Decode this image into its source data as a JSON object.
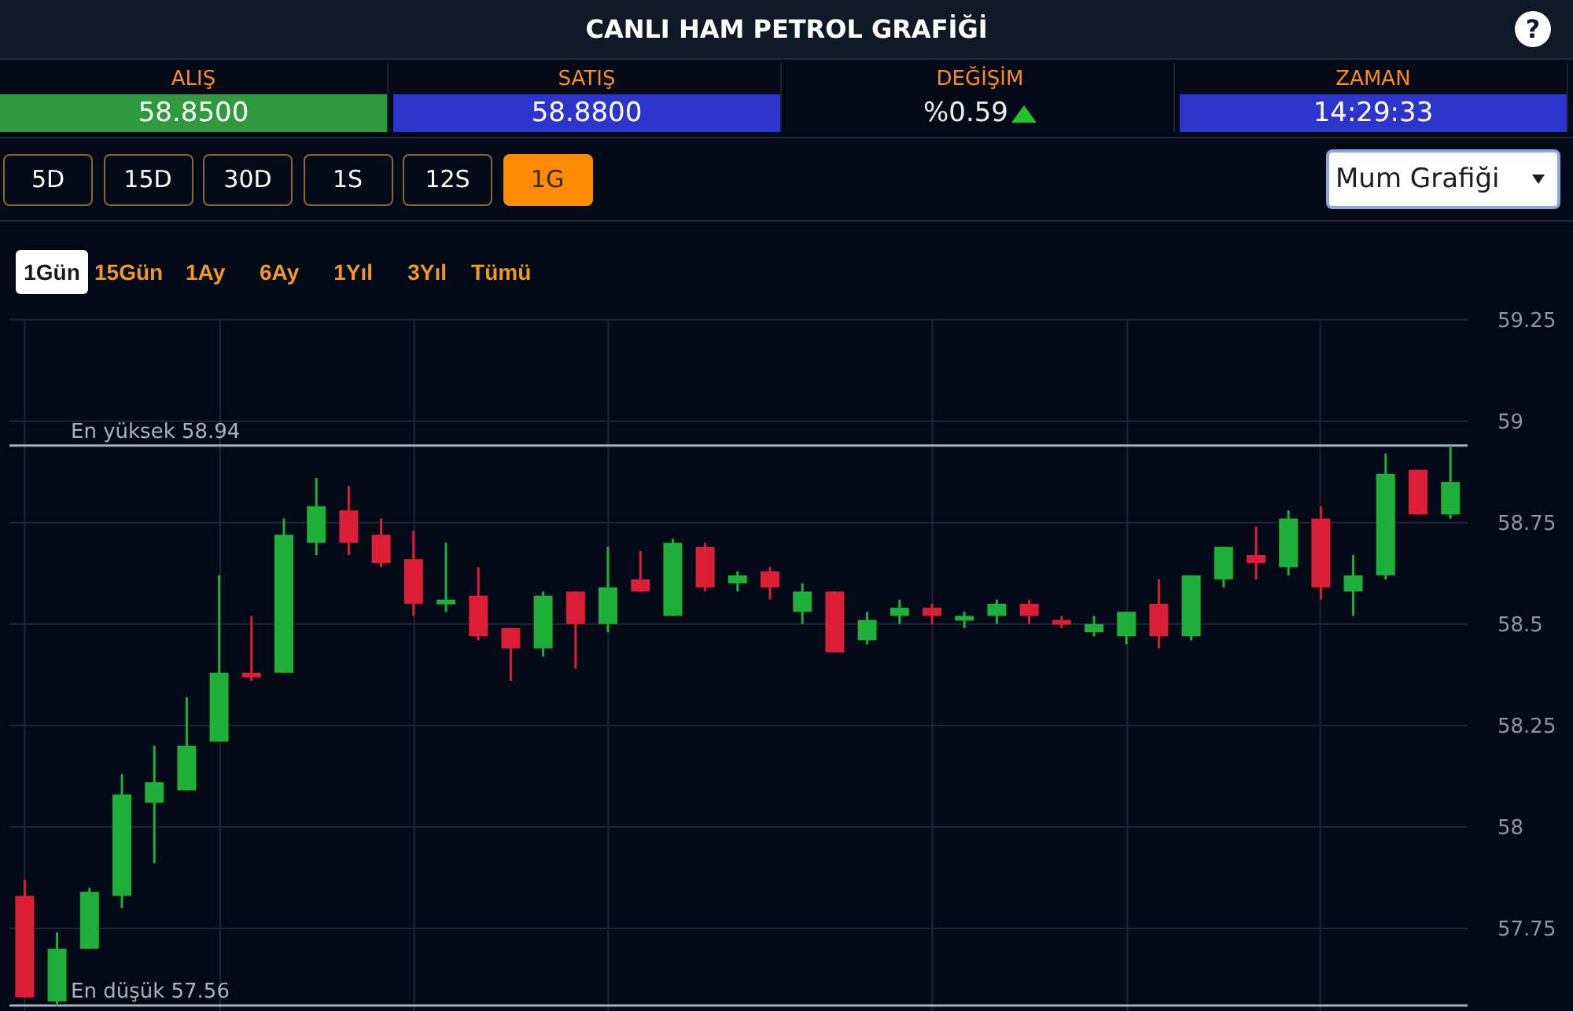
{
  "header": {
    "title": "CANLI HAM PETROL GRAFİĞİ",
    "help": "?"
  },
  "quotes": [
    {
      "kind": "bar",
      "label": "ALIŞ",
      "value": "58.8500",
      "color": "#2e9a3b"
    },
    {
      "kind": "bar",
      "label": "SATIŞ",
      "value": "58.8800",
      "color": "#2b35cc"
    },
    {
      "kind": "change",
      "label": "DEĞİŞİM",
      "value": "%0.59",
      "rising": true
    },
    {
      "kind": "bar",
      "label": "ZAMAN",
      "value": "14:29:33",
      "color": "#2b35cc"
    }
  ],
  "intervals": [
    {
      "label": "5D",
      "selected": false
    },
    {
      "label": "15D",
      "selected": false
    },
    {
      "label": "30D",
      "selected": false
    },
    {
      "label": "1S",
      "selected": false
    },
    {
      "label": "12S",
      "selected": false
    },
    {
      "label": "1G",
      "selected": true
    }
  ],
  "chart_type": {
    "value": "Mum Grafiği"
  },
  "ranges": [
    {
      "label": "1Gün",
      "selected": true
    },
    {
      "label": "15Gün",
      "selected": false
    },
    {
      "label": "1Ay",
      "selected": false
    },
    {
      "label": "6Ay",
      "selected": false
    },
    {
      "label": "1Yıl",
      "selected": false
    },
    {
      "label": "3Yıl",
      "selected": false
    },
    {
      "label": "Tümü",
      "selected": false
    }
  ],
  "chart": {
    "chart_data": {
      "type": "candlestick",
      "ohlc": [
        [
          57.83,
          57.87,
          57.58,
          57.58
        ],
        [
          57.57,
          57.74,
          57.56,
          57.7
        ],
        [
          57.7,
          57.85,
          57.7,
          57.84
        ],
        [
          57.83,
          58.13,
          57.8,
          58.08
        ],
        [
          58.06,
          58.2,
          57.91,
          58.11
        ],
        [
          58.09,
          58.32,
          58.09,
          58.2
        ],
        [
          58.21,
          58.62,
          58.21,
          58.38
        ],
        [
          58.38,
          58.52,
          58.36,
          58.37
        ],
        [
          58.38,
          58.76,
          58.38,
          58.72
        ],
        [
          58.7,
          58.86,
          58.67,
          58.79
        ],
        [
          58.78,
          58.84,
          58.67,
          58.7
        ],
        [
          58.72,
          58.76,
          58.64,
          58.65
        ],
        [
          58.66,
          58.73,
          58.52,
          58.55
        ],
        [
          58.55,
          58.7,
          58.53,
          58.56
        ],
        [
          58.57,
          58.64,
          58.46,
          58.47
        ],
        [
          58.49,
          58.49,
          58.36,
          58.44
        ],
        [
          58.44,
          58.58,
          58.42,
          58.57
        ],
        [
          58.58,
          58.58,
          58.39,
          58.5
        ],
        [
          58.5,
          58.69,
          58.48,
          58.59
        ],
        [
          58.61,
          58.68,
          58.58,
          58.58
        ],
        [
          58.52,
          58.71,
          58.52,
          58.7
        ],
        [
          58.69,
          58.7,
          58.58,
          58.59
        ],
        [
          58.6,
          58.63,
          58.58,
          58.62
        ],
        [
          58.63,
          58.64,
          58.56,
          58.59
        ],
        [
          58.53,
          58.6,
          58.5,
          58.58
        ],
        [
          58.58,
          58.58,
          58.43,
          58.43
        ],
        [
          58.46,
          58.53,
          58.45,
          58.51
        ],
        [
          58.52,
          58.56,
          58.5,
          58.54
        ],
        [
          58.54,
          58.55,
          58.5,
          58.52
        ],
        [
          58.51,
          58.53,
          58.49,
          58.52
        ],
        [
          58.52,
          58.56,
          58.5,
          58.55
        ],
        [
          58.55,
          58.56,
          58.5,
          58.52
        ],
        [
          58.51,
          58.52,
          58.49,
          58.5
        ],
        [
          58.48,
          58.52,
          58.47,
          58.5
        ],
        [
          58.47,
          58.53,
          58.45,
          58.53
        ],
        [
          58.55,
          58.61,
          58.44,
          58.47
        ],
        [
          58.47,
          58.62,
          58.46,
          58.62
        ],
        [
          58.61,
          58.69,
          58.59,
          58.69
        ],
        [
          58.67,
          58.74,
          58.61,
          58.65
        ],
        [
          58.64,
          58.78,
          58.62,
          58.76
        ],
        [
          58.76,
          58.79,
          58.56,
          58.59
        ],
        [
          58.58,
          58.67,
          58.52,
          58.62
        ],
        [
          58.62,
          58.92,
          58.61,
          58.87
        ],
        [
          58.88,
          58.88,
          58.77,
          58.77
        ],
        [
          58.77,
          58.94,
          58.76,
          58.85
        ]
      ],
      "ylim": [
        57.56,
        59.25
      ],
      "yticks": [
        59.25,
        59,
        58.75,
        58.5,
        58.25,
        58,
        57.75
      ],
      "grid": true,
      "ref_lines": [
        {
          "axis": "y",
          "value": 58.94,
          "label": "En yüksek 58.94"
        },
        {
          "axis": "y",
          "value": 57.56,
          "label": "En düşük 57.56"
        }
      ]
    }
  }
}
